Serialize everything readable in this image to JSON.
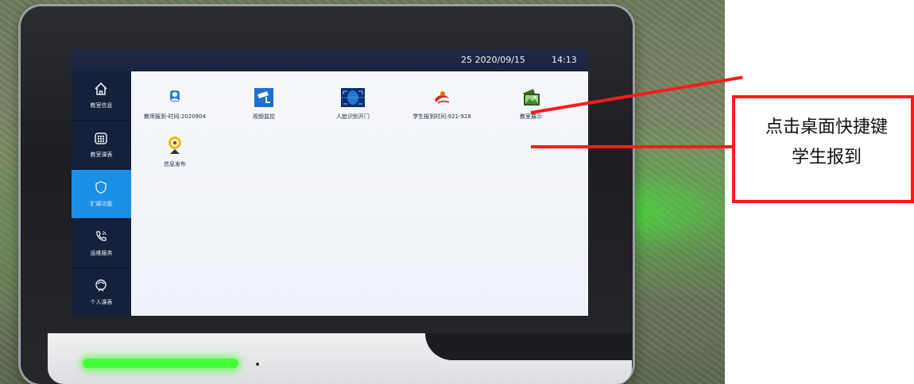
{
  "statusbar": {
    "date": "25  2020/09/15",
    "time": "14:13"
  },
  "sidebar": {
    "items": [
      {
        "label": "教室信息",
        "icon": "home-icon",
        "active": false
      },
      {
        "label": "教室课表",
        "icon": "schedule-grid-icon",
        "active": false
      },
      {
        "label": "扩展功能",
        "icon": "shield-icon",
        "active": true
      },
      {
        "label": "运维服务",
        "icon": "phone-support-icon",
        "active": false
      },
      {
        "label": "个人课表",
        "icon": "person-icon",
        "active": false
      }
    ]
  },
  "desktop": {
    "apps": [
      {
        "label": "教师报到-时间:2020904",
        "icon": "teacher-checkin-icon"
      },
      {
        "label": "视频监控",
        "icon": "surveillance-camera-icon"
      },
      {
        "label": "人脸识别开门",
        "icon": "face-recognition-icon"
      },
      {
        "label": "学生报到时间:921-928",
        "icon": "student-checkin-icon"
      },
      {
        "label": "教室展示",
        "icon": "photo-gallery-icon"
      },
      {
        "label": "信息发布",
        "icon": "webcam-broadcast-icon"
      }
    ]
  },
  "annotation": {
    "text": "点击桌面快捷键学生报到"
  },
  "colors": {
    "annotation": "#ff1b1b",
    "active_nav": "#1a8fe6",
    "led": "#43ff3a"
  }
}
